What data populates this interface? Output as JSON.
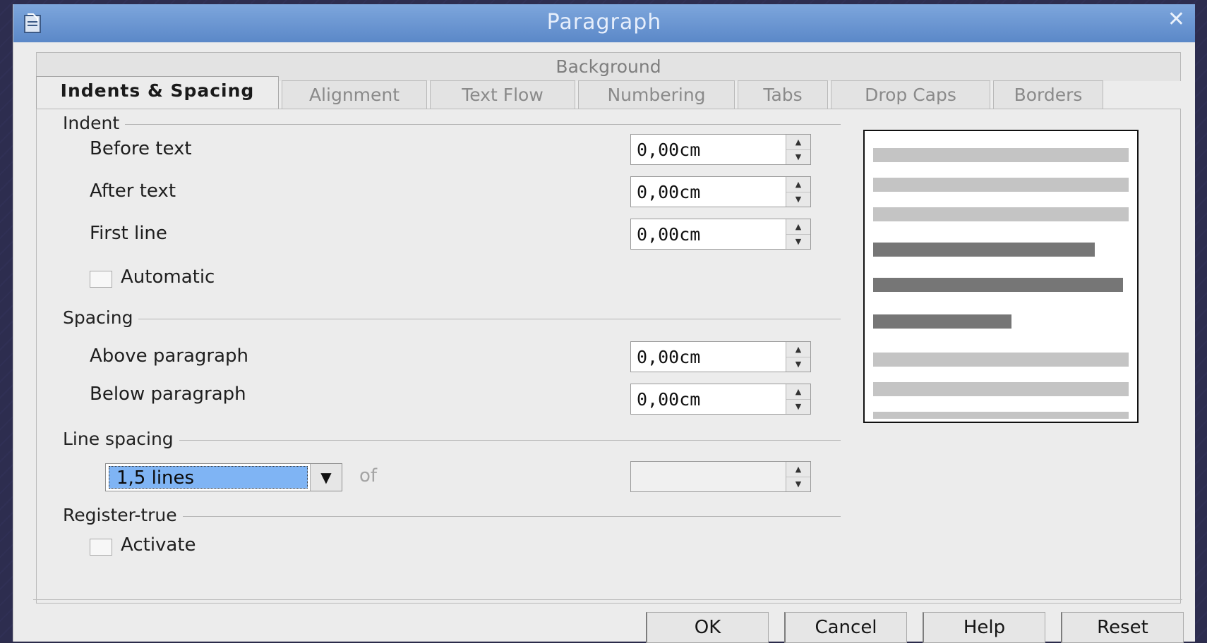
{
  "window": {
    "title": "Paragraph",
    "close_glyph": "✕",
    "app_icon": "document-icon"
  },
  "tabs": {
    "top_row": [
      "Background"
    ],
    "bottom_row": [
      "Indents & Spacing",
      "Alignment",
      "Text Flow",
      "Numbering",
      "Tabs",
      "Drop Caps",
      "Borders"
    ],
    "active": "Indents & Spacing"
  },
  "indent": {
    "section_label": "Indent",
    "before_text": {
      "label": "Before text",
      "value": "0,00cm"
    },
    "after_text": {
      "label": "After text",
      "value": "0,00cm"
    },
    "first_line": {
      "label": "First line",
      "value": "0,00cm"
    },
    "automatic": {
      "label": "Automatic",
      "checked": false
    }
  },
  "spacing": {
    "section_label": "Spacing",
    "above": {
      "label": "Above paragraph",
      "value": "0,00cm"
    },
    "below": {
      "label": "Below paragraph",
      "value": "0,00cm"
    }
  },
  "line_spacing": {
    "section_label": "Line spacing",
    "selected": "1,5 lines",
    "of_label": "of",
    "value": ""
  },
  "register_true": {
    "section_label": "Register-true",
    "activate": {
      "label": "Activate",
      "checked": false
    }
  },
  "preview": {
    "light_bar_color": "#c4c4c4",
    "dark_bar_color": "#767676"
  },
  "buttons": {
    "ok": "OK",
    "cancel": "Cancel",
    "help": "Help",
    "reset": "Reset"
  }
}
